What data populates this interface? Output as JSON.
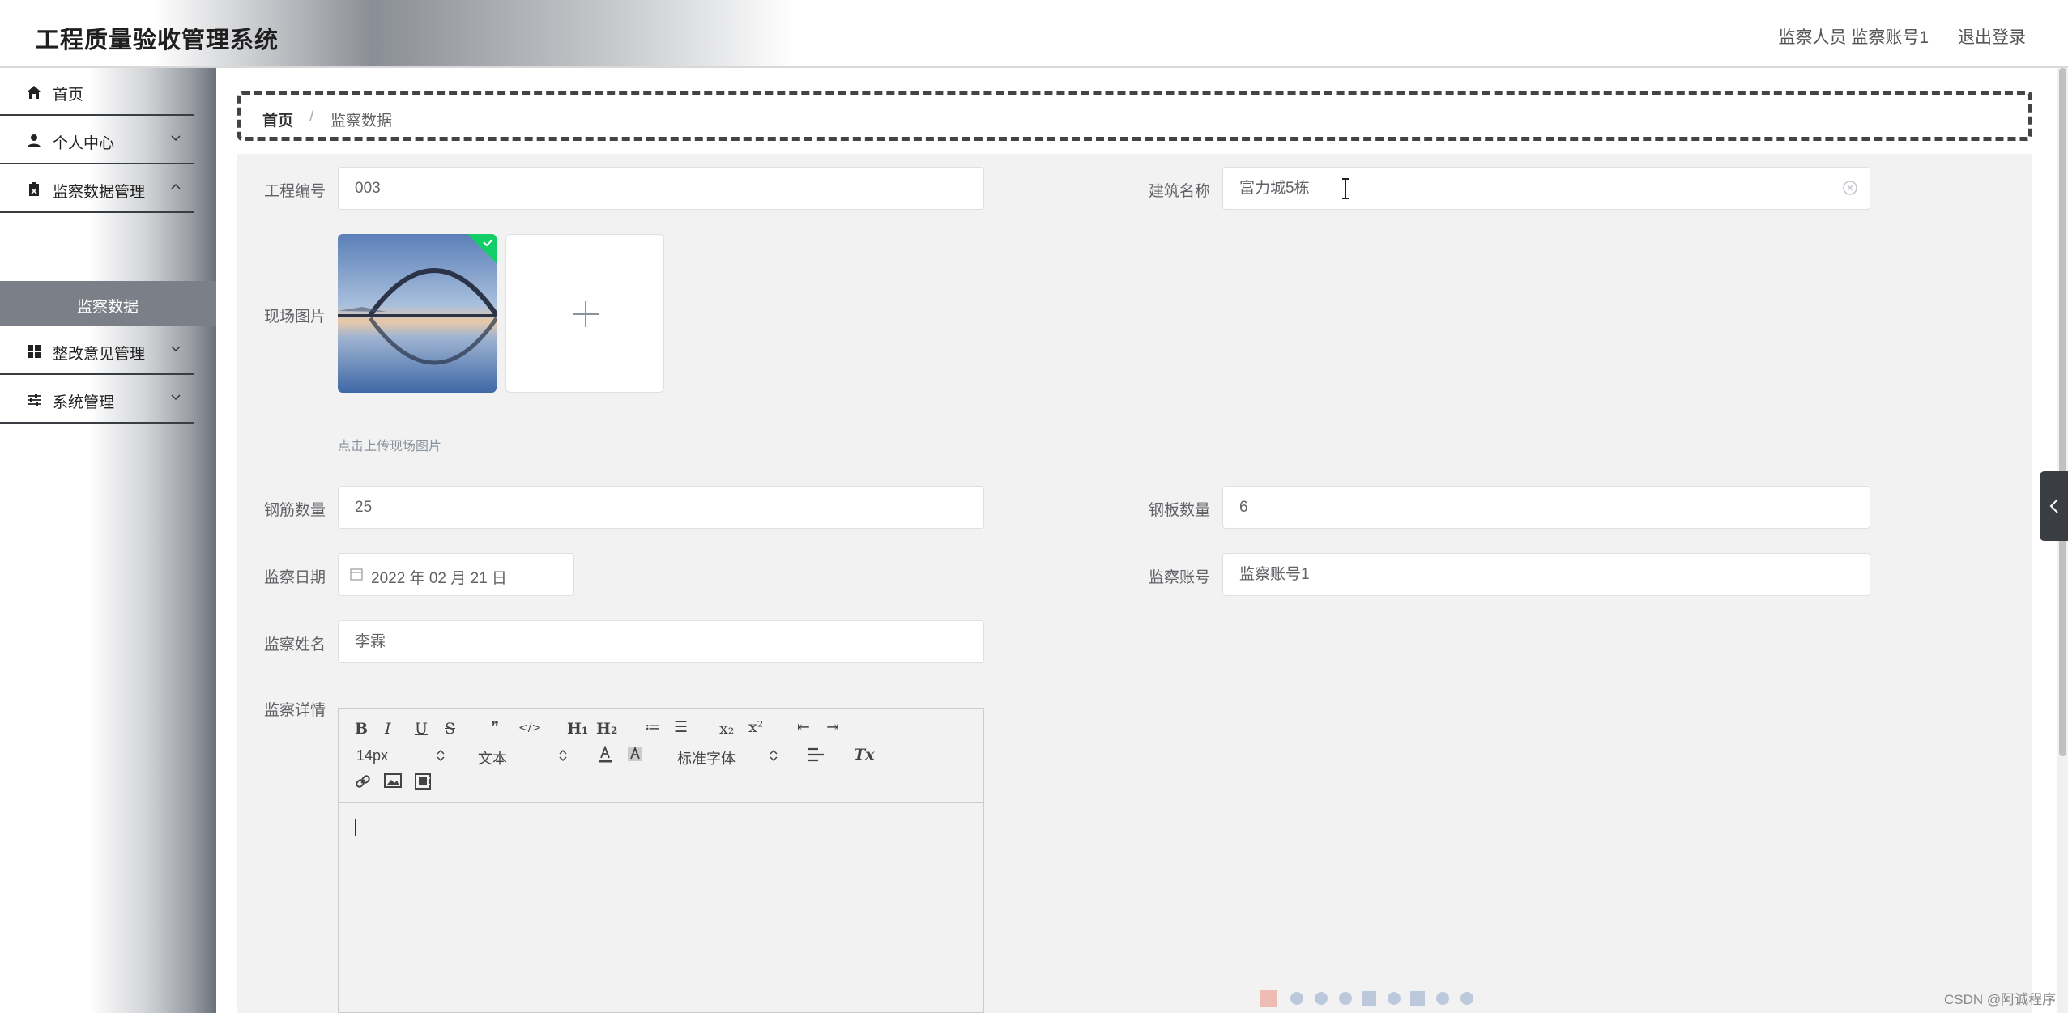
{
  "header": {
    "app_title": "工程质量验收管理系统",
    "user_info": "监察人员 监察账号1",
    "logout_label": "退出登录"
  },
  "sidebar": {
    "items": [
      {
        "label": "首页",
        "icon": "home-icon"
      },
      {
        "label": "个人中心",
        "icon": "user-icon"
      },
      {
        "label": "监察数据管理",
        "icon": "clipboard-icon"
      },
      {
        "label": "整改意见管理",
        "icon": "grid-icon"
      },
      {
        "label": "系统管理",
        "icon": "sliders-icon"
      }
    ],
    "active_sub": "监察数据"
  },
  "breadcrumb": {
    "home": "首页",
    "separator": "/",
    "current": "监察数据"
  },
  "form": {
    "project_no": {
      "label": "工程编号",
      "value": "003"
    },
    "building_name": {
      "label": "建筑名称",
      "value": "富力城5栋"
    },
    "site_photo": {
      "label": "现场图片",
      "tip": "点击上传现场图片"
    },
    "rebar_qty": {
      "label": "钢筋数量",
      "value": "25"
    },
    "steel_plate_qty": {
      "label": "钢板数量",
      "value": "6"
    },
    "inspect_date": {
      "label": "监察日期",
      "value": "2022 年 02 月 21 日"
    },
    "inspector_account": {
      "label": "监察账号",
      "value": "监察账号1"
    },
    "inspector_name": {
      "label": "监察姓名",
      "value": "李霖"
    },
    "details": {
      "label": "监察详情"
    }
  },
  "editor": {
    "bold": "B",
    "italic": "I",
    "underline": "U",
    "strike": "S",
    "quote": "❞",
    "code": "</>",
    "h1": "H₁",
    "h2": "H₂",
    "ordered_list": "≔",
    "bullet_list": "☰",
    "subscript": "x₂",
    "superscript": "x²",
    "outdent": "⇤",
    "indent": "⇥",
    "size": "14px",
    "header_type": "文本",
    "font": "标准字体",
    "clean": "Tx"
  },
  "watermark": "CSDN @阿诚程序",
  "colors": {
    "sidebar_active": "#7b7f87",
    "check_green": "#13ce66"
  }
}
